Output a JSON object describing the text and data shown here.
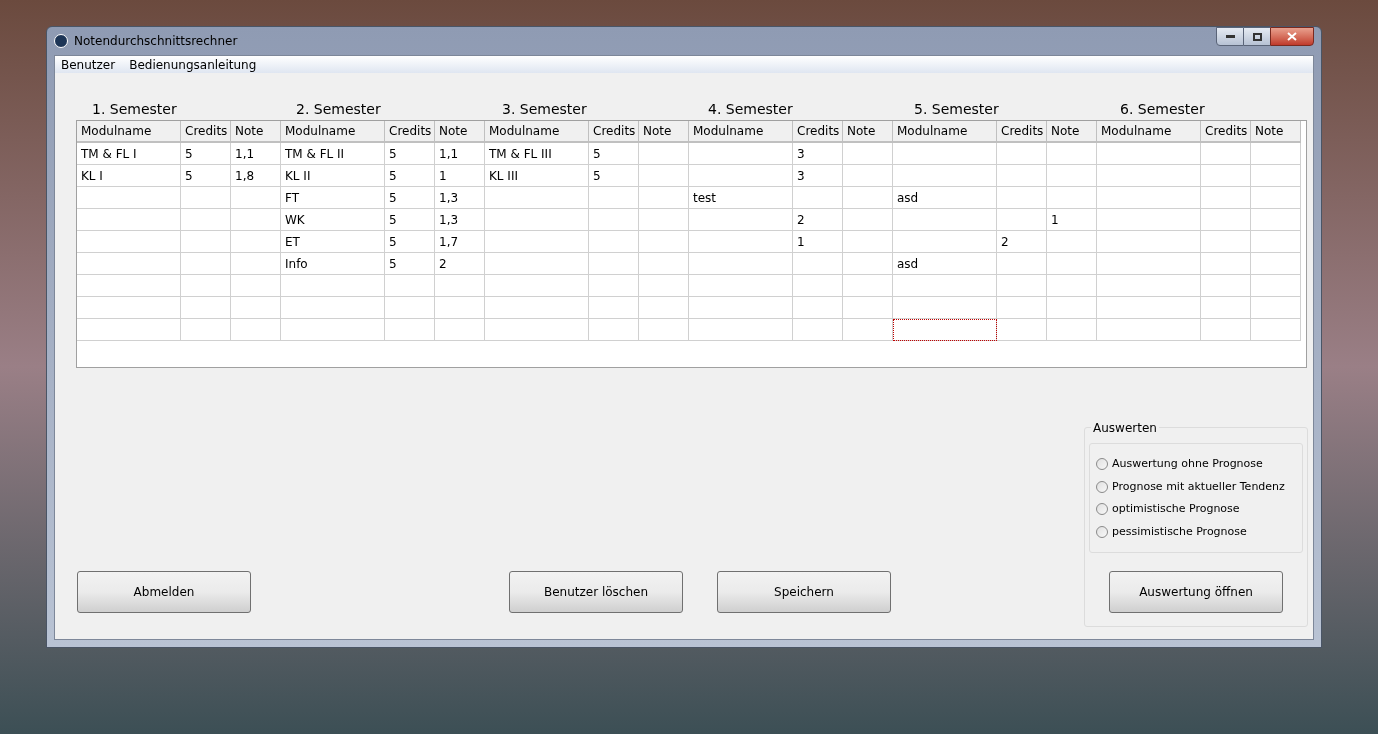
{
  "window": {
    "title": "Notendurchschnittsrechner"
  },
  "menu": [
    "Benutzer",
    "Bedienungsanleitung"
  ],
  "semesters": [
    {
      "title": "1. Semester",
      "columns": [
        "Modulname",
        "Credits",
        "Note"
      ],
      "rows": [
        {
          "modulname": "TM & FL I",
          "credits": "5",
          "note": "1,1"
        },
        {
          "modulname": "KL I",
          "credits": "5",
          "note": "1,8"
        },
        {},
        {},
        {},
        {},
        {},
        {},
        {}
      ]
    },
    {
      "title": "2. Semester",
      "columns": [
        "Modulname",
        "Credits",
        "Note"
      ],
      "rows": [
        {
          "modulname": "TM & FL II",
          "credits": "5",
          "note": "1,1"
        },
        {
          "modulname": "KL II",
          "credits": "5",
          "note": "1"
        },
        {
          "modulname": "FT",
          "credits": "5",
          "note": "1,3"
        },
        {
          "modulname": "WK",
          "credits": "5",
          "note": "1,3"
        },
        {
          "modulname": "ET",
          "credits": "5",
          "note": "1,7"
        },
        {
          "modulname": "Info",
          "credits": "5",
          "note": "2"
        },
        {},
        {},
        {}
      ]
    },
    {
      "title": "3. Semester",
      "columns": [
        "Modulname",
        "Credits",
        "Note"
      ],
      "rows": [
        {
          "modulname": "TM & FL III",
          "credits": "5"
        },
        {
          "modulname": "KL III",
          "credits": "5"
        },
        {},
        {},
        {},
        {},
        {},
        {},
        {}
      ]
    },
    {
      "title": "4. Semester",
      "columns": [
        "Modulname",
        "Credits",
        "Note"
      ],
      "rows": [
        {
          "credits": "3"
        },
        {
          "credits": "3"
        },
        {
          "modulname": "test"
        },
        {
          "credits": "2"
        },
        {
          "credits": "1"
        },
        {},
        {},
        {},
        {}
      ]
    },
    {
      "title": "5. Semester",
      "columns": [
        "Modulname",
        "Credits",
        "Note"
      ],
      "rows": [
        {},
        {},
        {
          "modulname": "asd"
        },
        {
          "note": "1"
        },
        {
          "credits": "2"
        },
        {
          "modulname": "asd"
        },
        {},
        {},
        {
          "focused": true
        }
      ]
    },
    {
      "title": "6. Semester",
      "columns": [
        "Modulname",
        "Credits",
        "Note"
      ],
      "rows": [
        {},
        {},
        {},
        {},
        {},
        {},
        {},
        {},
        {}
      ]
    }
  ],
  "buttons": [
    "Abmelden",
    "Benutzer löschen",
    "Speichern"
  ],
  "evaluation": {
    "title": "Auswerten",
    "options": [
      {
        "label": "Auswertung ohne Prognose",
        "selected": false
      },
      {
        "label": "Prognose mit aktueller Tendenz",
        "selected": false
      },
      {
        "label": "optimistische Prognose",
        "selected": false
      },
      {
        "label": "pessimistische Prognose",
        "selected": false
      }
    ],
    "button": "Auswertung öffnen"
  }
}
